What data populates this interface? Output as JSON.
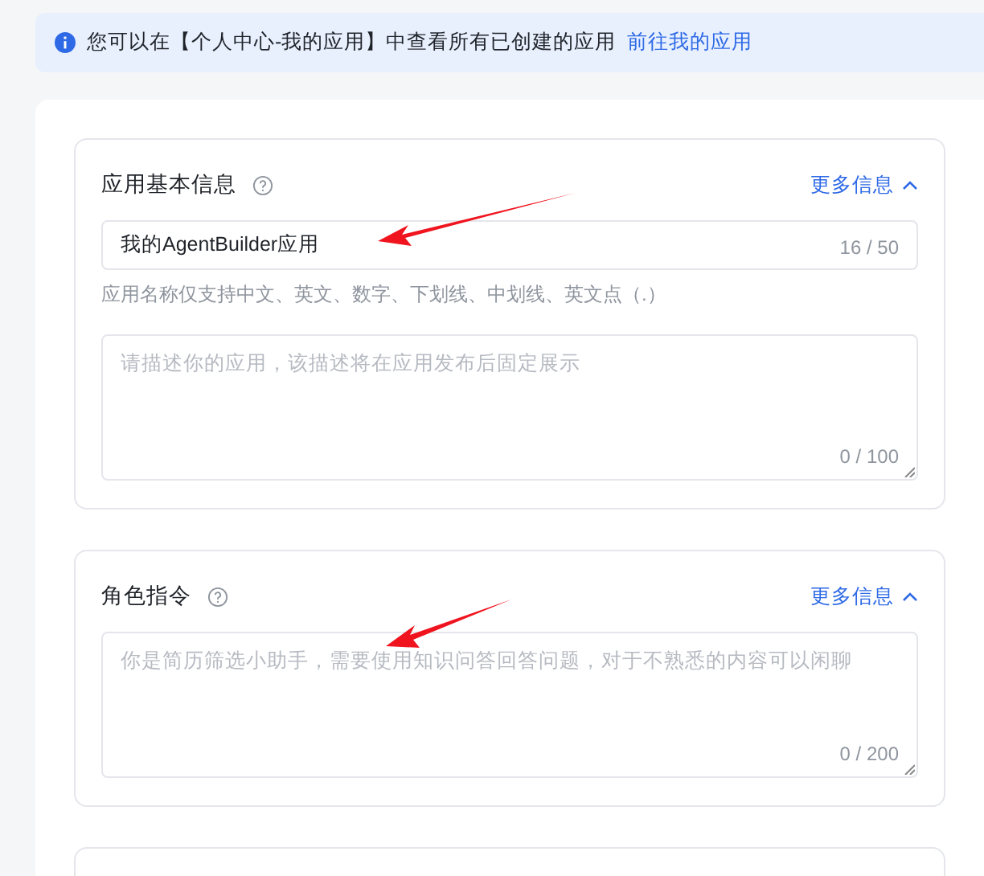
{
  "banner": {
    "text": "您可以在【个人中心-我的应用】中查看所有已创建的应用",
    "link": "前往我的应用"
  },
  "cards": [
    {
      "title": "应用基本信息",
      "more": "更多信息",
      "expanded": true,
      "fields": [
        {
          "kind": "input",
          "value": "我的AgentBuilder应用",
          "counter": "16 / 50",
          "hint": "应用名称仅支持中文、英文、数字、下划线、中划线、英文点（.）"
        },
        {
          "kind": "textarea",
          "placeholder": "请描述你的应用，该描述将在应用发布后固定展示",
          "counter": "0 / 100"
        }
      ]
    },
    {
      "title": "角色指令",
      "more": "更多信息",
      "expanded": true,
      "fields": [
        {
          "kind": "textarea",
          "placeholder": "你是简历筛选小助手，需要使用知识问答回答问题，对于不熟悉的内容可以闲聊",
          "counter": "0 / 200"
        }
      ]
    }
  ]
}
